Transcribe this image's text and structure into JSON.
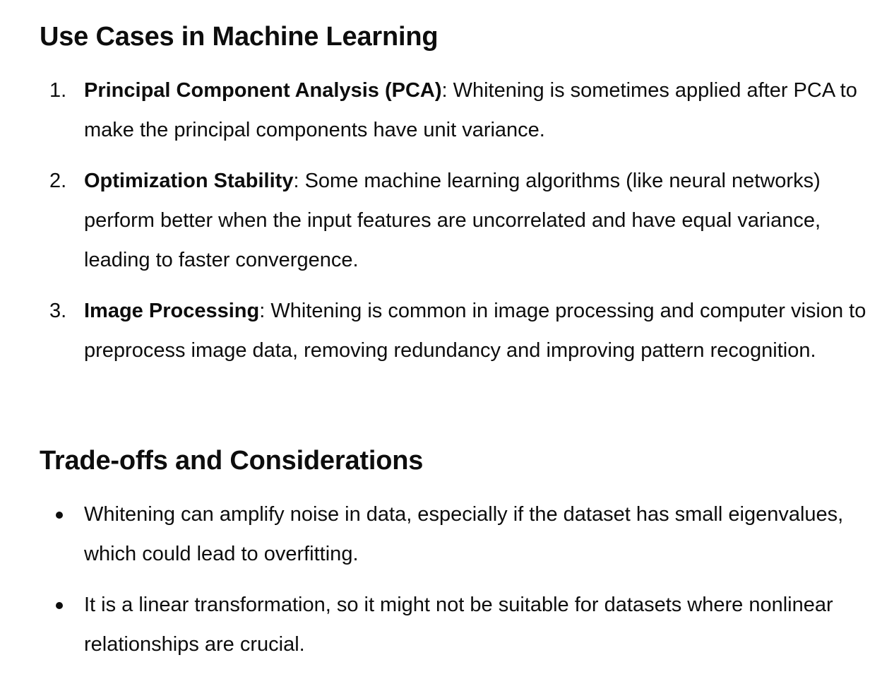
{
  "use_cases": {
    "heading": "Use Cases in Machine Learning",
    "items": [
      {
        "number": "1.",
        "term": "Principal Component Analysis (PCA)",
        "text": ": Whitening is sometimes applied after PCA to make the principal components have unit variance."
      },
      {
        "number": "2.",
        "term": "Optimization Stability",
        "text": ": Some machine learning algorithms (like neural networks) perform better when the input features are uncorrelated and have equal variance, leading to faster convergence."
      },
      {
        "number": "3.",
        "term": "Image Processing",
        "text": ": Whitening is common in image processing and computer vision to preprocess image data, removing redundancy and improving pattern recognition."
      }
    ]
  },
  "tradeoffs": {
    "heading": "Trade-offs and Considerations",
    "items": [
      {
        "text": "Whitening can amplify noise in data, especially if the dataset has small eigenvalues, which could lead to overfitting."
      },
      {
        "text": "It is a linear transformation, so it might not be suitable for datasets where nonlinear relationships are crucial."
      }
    ]
  }
}
